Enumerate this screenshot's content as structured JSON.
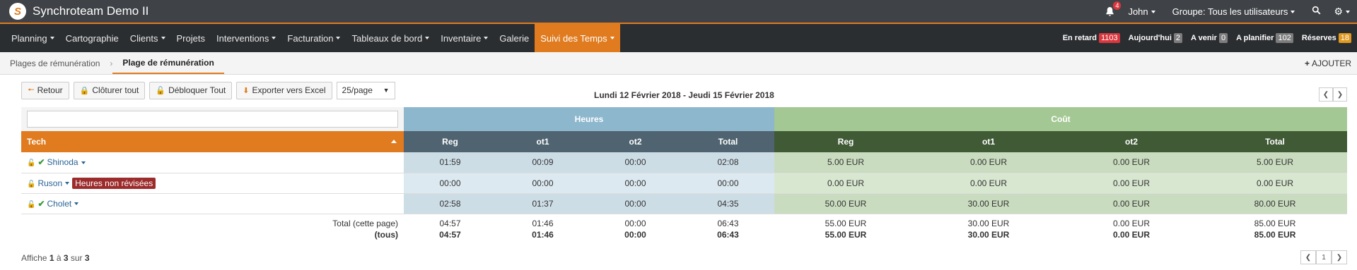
{
  "app": {
    "title": "Synchroteam Demo II",
    "logo_letter": "S"
  },
  "topbar": {
    "notifications_count": "4",
    "user": "John",
    "group": "Groupe: Tous les utilisateurs"
  },
  "nav": {
    "items": [
      "Planning",
      "Cartographie",
      "Clients",
      "Projets",
      "Interventions",
      "Facturation",
      "Tableaux de bord",
      "Inventaire",
      "Galerie",
      "Suivi des Temps"
    ],
    "stats": [
      {
        "label": "En retard",
        "count": "1103",
        "color": "#d9363e"
      },
      {
        "label": "Aujourd'hui",
        "count": "2",
        "color": "#7d7d7d"
      },
      {
        "label": "A venir",
        "count": "0",
        "color": "#7d7d7d"
      },
      {
        "label": "A planifier",
        "count": "102",
        "color": "#7d7d7d"
      },
      {
        "label": "Réserves",
        "count": "18",
        "color": "#e0991f"
      }
    ]
  },
  "breadcrumb": {
    "parent": "Plages de rémunération",
    "current": "Plage de rémunération",
    "add": "AJOUTER"
  },
  "toolbar": {
    "back": "Retour",
    "close_all": "Clôturer tout",
    "unlock_all": "Débloquer Tout",
    "export": "Exporter vers Excel",
    "per_page": "25/page",
    "date_range": "Lundi 12 Février 2018 - Jeudi 15 Février 2018"
  },
  "table": {
    "group_hours": "Heures",
    "group_cost": "Coût",
    "col_tech": "Tech",
    "cols": [
      "Reg",
      "ot1",
      "ot2",
      "Total"
    ],
    "rows": [
      {
        "name": "Shinoda",
        "checked": true,
        "badge": "",
        "hours": [
          "01:59",
          "00:09",
          "00:00",
          "02:08"
        ],
        "cost": [
          "5.00 EUR",
          "0.00 EUR",
          "0.00 EUR",
          "5.00 EUR"
        ]
      },
      {
        "name": "Ruson",
        "checked": false,
        "badge": "Heures non révisées",
        "hours": [
          "00:00",
          "00:00",
          "00:00",
          "00:00"
        ],
        "cost": [
          "0.00 EUR",
          "0.00 EUR",
          "0.00 EUR",
          "0.00 EUR"
        ]
      },
      {
        "name": "Cholet",
        "checked": true,
        "badge": "",
        "hours": [
          "02:58",
          "01:37",
          "00:00",
          "04:35"
        ],
        "cost": [
          "50.00 EUR",
          "30.00 EUR",
          "0.00 EUR",
          "80.00 EUR"
        ]
      }
    ],
    "total_page": {
      "label": "Total (cette page)",
      "hours": [
        "04:57",
        "01:46",
        "00:00",
        "06:43"
      ],
      "cost": [
        "55.00 EUR",
        "30.00 EUR",
        "0.00 EUR",
        "85.00 EUR"
      ]
    },
    "total_all": {
      "label": "(tous)",
      "hours": [
        "04:57",
        "01:46",
        "00:00",
        "06:43"
      ],
      "cost": [
        "55.00 EUR",
        "30.00 EUR",
        "0.00 EUR",
        "85.00 EUR"
      ]
    }
  },
  "footer": {
    "prefix": "Affiche",
    "from": "1",
    "to": "3",
    "total": "3",
    "page": "1"
  }
}
